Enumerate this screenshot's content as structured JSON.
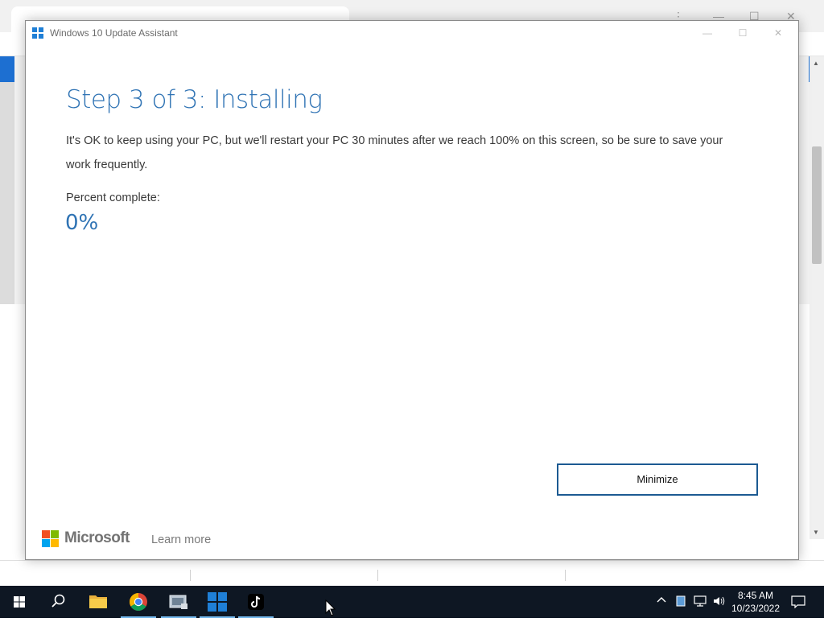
{
  "window": {
    "title": "Windows 10 Update Assistant",
    "minimize_glyph": "—",
    "maximize_glyph": "☐",
    "close_glyph": "✕"
  },
  "main": {
    "heading": "Step 3 of 3: Installing",
    "description": "It's OK to keep using your PC, but we'll restart your PC 30 minutes after we reach 100% on this screen, so be sure to save your work frequently.",
    "percent_label": "Percent complete:",
    "percent_value": "0%",
    "minimize_button": "Minimize"
  },
  "footer": {
    "brand": "Microsoft",
    "learn_more": "Learn more"
  },
  "taskbar": {
    "time": "8:45 AM",
    "date": "10/23/2022",
    "icons": [
      "windows-start-icon",
      "search-icon",
      "file-explorer-icon",
      "chrome-icon",
      "media-tool-icon",
      "update-assistant-icon",
      "tiktok-icon"
    ],
    "tray_icons": [
      "chevron-up-icon",
      "battery-icon",
      "network-icon",
      "volume-icon",
      "notifications-icon"
    ]
  },
  "colors": {
    "accent": "#2f73b4",
    "button_border": "#1c5a92",
    "taskbar": "#0e1723",
    "ms_red": "#f25022",
    "ms_green": "#7fba00",
    "ms_blue": "#00a4ef",
    "ms_yellow": "#ffb900"
  }
}
